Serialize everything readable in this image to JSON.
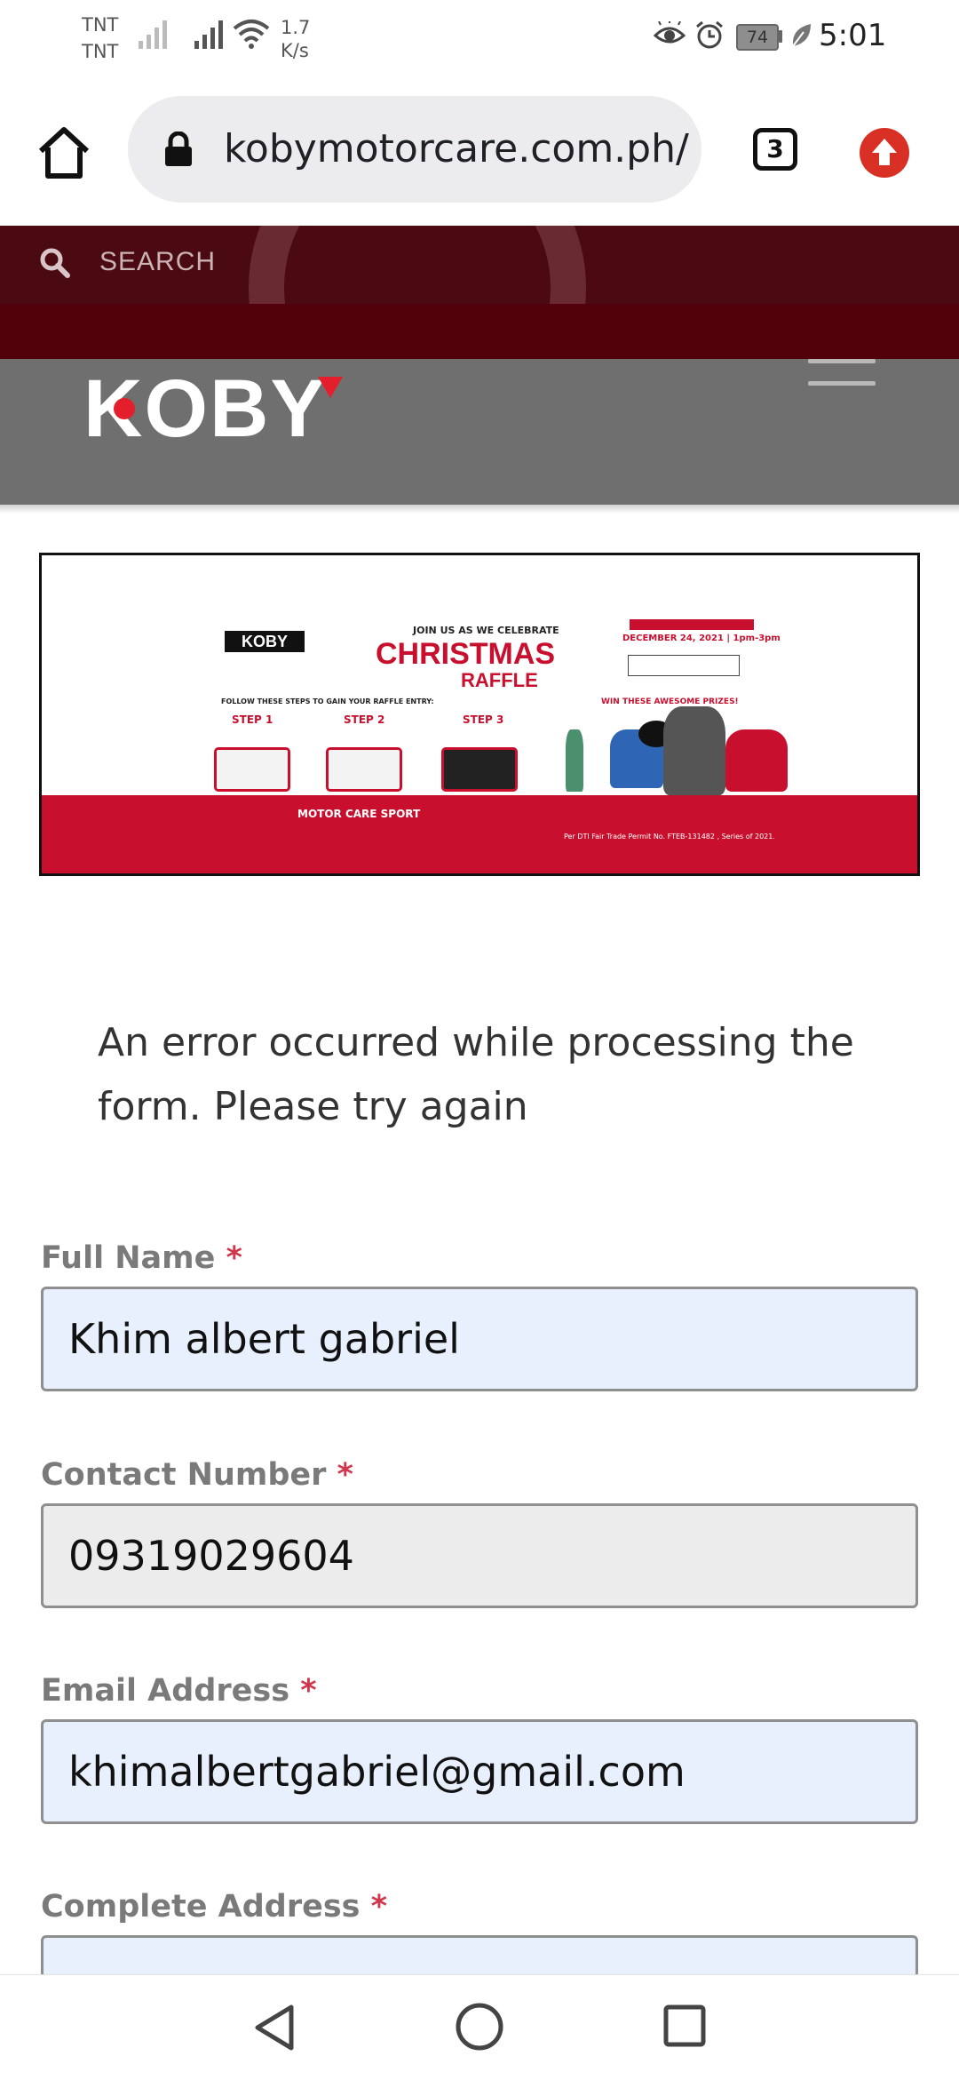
{
  "status_bar": {
    "carrier_1": "TNT",
    "carrier_2": "TNT",
    "net_speed_value": "1.7",
    "net_speed_unit": "K/s",
    "battery": "74",
    "time": "5:01"
  },
  "browser": {
    "url": "kobymotorcare.com.ph/",
    "tab_count": "3"
  },
  "site_header": {
    "search_label": "SEARCH",
    "logo_text": "KOBY"
  },
  "banner": {
    "logo": "KOBY",
    "join_text": "JOIN US AS WE CELEBRATE",
    "title_line1": "CHRISTMAS",
    "title_line2": "RAFFLE",
    "date_text": "DECEMBER 24, 2021 | 1pm-3pm",
    "follow_text": "FOLLOW THESE STEPS TO GAIN YOUR RAFFLE ENTRY:",
    "win_text": "WIN THESE AWESOME PRIZES!",
    "steps": [
      "STEP 1",
      "STEP 2",
      "STEP 3"
    ],
    "footer_brand": "MOTOR CARE SPORT",
    "permit": "Per DTI Fair Trade Permit No. FTEB-131482 , Series of 2021."
  },
  "form": {
    "error_message": "An error occurred while processing the form. Please try again",
    "required_mark": "*",
    "fields": [
      {
        "label": "Full Name",
        "value": "Khim albert gabriel"
      },
      {
        "label": "Contact Number",
        "value": "09319029604"
      },
      {
        "label": "Email Address",
        "value": "khimalbertgabriel@gmail.com"
      },
      {
        "label": "Complete Address",
        "value": ""
      }
    ]
  },
  "colors": {
    "brand_red": "#c8102e",
    "header_maroon": "#3d0008",
    "autofill_blue": "#e8f0fe",
    "required_red": "#d1364c"
  }
}
